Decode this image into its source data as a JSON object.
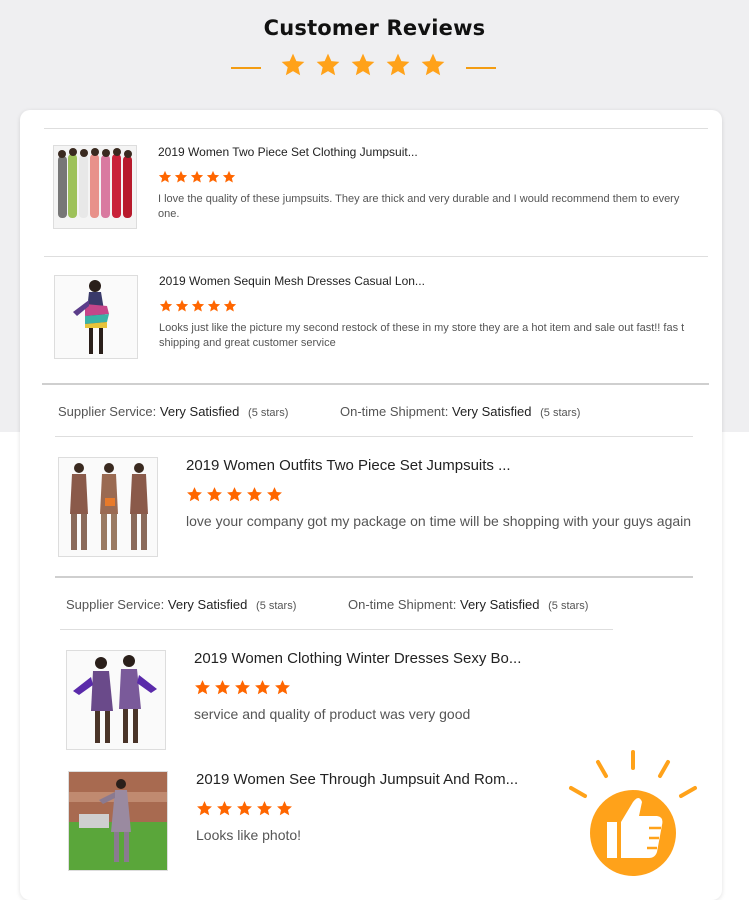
{
  "page": {
    "title": "Customer Reviews"
  },
  "colors": {
    "accent": "#f39c12",
    "star": "#ff6600",
    "title_star": "#ffa21a"
  },
  "reviews": [
    {
      "product": "2019 Women Two Piece Set Clothing Jumpsuit...",
      "rating": 5,
      "text": "I love the quality of these jumpsuits. They are thick and very durable and I would recommend them to every one."
    },
    {
      "product": "2019 Women Sequin Mesh Dresses Casual Lon...",
      "rating": 5,
      "text": "Looks just like the picture my second restock of these in my store they are a hot item and sale out fast!! fas t shipping and great customer service"
    },
    {
      "product": "2019 Women Outfits Two Piece Set Jumpsuits ...",
      "rating": 5,
      "text": "love your company got my package on time will be shopping with your guys again"
    },
    {
      "product": "2019 Women Clothing Winter Dresses Sexy Bo...",
      "rating": 5,
      "text": "service and quality of product was very good"
    },
    {
      "product": "2019 Women See Through Jumpsuit And Rom...",
      "rating": 5,
      "text": "Looks like photo!"
    }
  ],
  "service_rows": [
    {
      "supplier_label": "Supplier Service:",
      "supplier_value": "Very Satisfied",
      "supplier_stars": "(5 stars)",
      "shipment_label": "On-time Shipment:",
      "shipment_value": "Very Satisfied",
      "shipment_stars": "(5 stars)"
    },
    {
      "supplier_label": "Supplier Service:",
      "supplier_value": "Very Satisfied",
      "supplier_stars": "(5 stars)",
      "shipment_label": "On-time Shipment:",
      "shipment_value": "Very Satisfied",
      "shipment_stars": "(5 stars)"
    }
  ],
  "icons": {
    "title_star": "star-icon",
    "rating_star": "star-icon",
    "badge": "thumbs-up-icon"
  }
}
